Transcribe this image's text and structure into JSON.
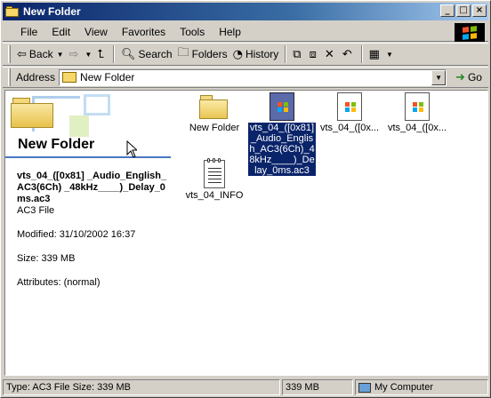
{
  "window": {
    "title": "New Folder"
  },
  "title_buttons": {
    "minimize": "_",
    "maximize": "□",
    "close": "×"
  },
  "menu": [
    "File",
    "Edit",
    "View",
    "Favorites",
    "Tools",
    "Help"
  ],
  "toolbar": {
    "back": "Back",
    "search": "Search",
    "folders": "Folders",
    "history": "History"
  },
  "address": {
    "label": "Address",
    "value": "New Folder",
    "go": "Go"
  },
  "web_view": {
    "folder_title": "New Folder",
    "file_name": "vts_04_([0x81] _Audio_English_AC3(6Ch) _48kHz____)_Delay_0ms.ac3",
    "file_type": "AC3 File",
    "modified": "Modified: 31/10/2002 16:37",
    "size": "Size: 339 MB",
    "attributes": "Attributes: (normal)"
  },
  "items": [
    {
      "label": "New Folder",
      "kind": "folder",
      "selected": false
    },
    {
      "label": "vts_04_([0x81]_Audio_English_AC3(6Ch)_48kHz____)_Delay_0ms.ac3",
      "kind": "media",
      "selected": true
    },
    {
      "label": "vts_04_([0x...",
      "kind": "media",
      "selected": false
    },
    {
      "label": "vts_04_([0x...",
      "kind": "media",
      "selected": false
    },
    {
      "label": "vts_04_INFO",
      "kind": "text",
      "selected": false
    }
  ],
  "status": {
    "left": "Type: AC3 File Size: 339 MB",
    "size": "339 MB",
    "zone": "My Computer"
  },
  "colors": {
    "title_bar": "#0a246a",
    "selection": "#0a246a",
    "face": "#d4d0c8"
  }
}
